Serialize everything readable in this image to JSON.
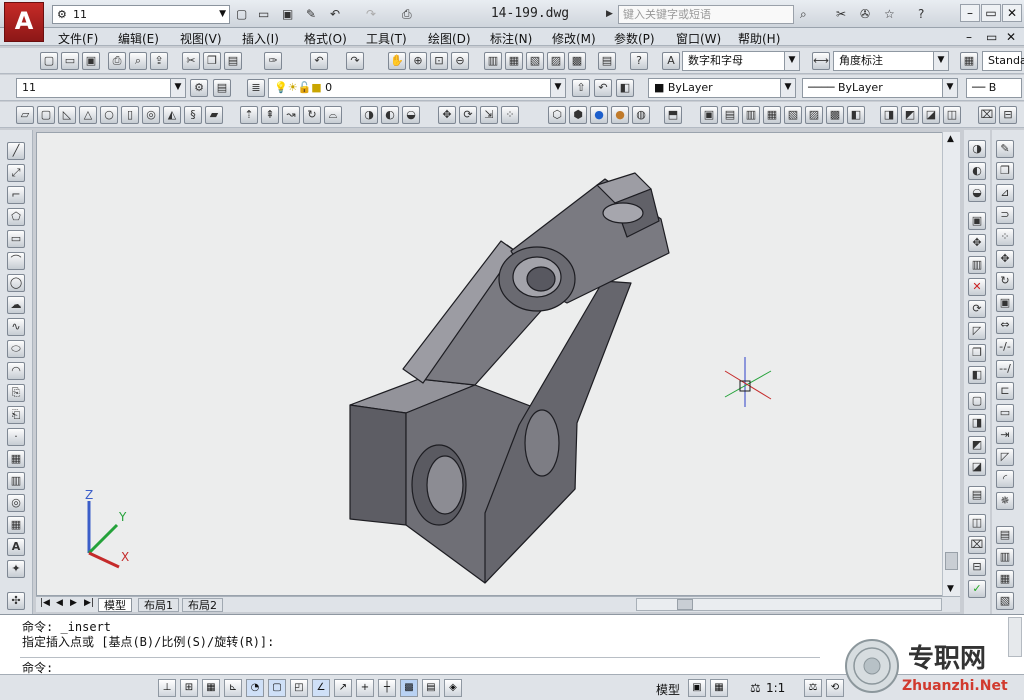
{
  "titlebar": {
    "workspace": "11",
    "filename": "14-199.dwg",
    "search_placeholder": "键入关键字或短语"
  },
  "menu": [
    "文件(F)",
    "编辑(E)",
    "视图(V)",
    "插入(I)",
    "格式(O)",
    "工具(T)",
    "绘图(D)",
    "标注(N)",
    "修改(M)",
    "参数(P)",
    "窗口(W)",
    "帮助(H)"
  ],
  "toolbar2": {
    "text_style": "数字和字母",
    "dim_style": "角度标注",
    "table_style": "Standa"
  },
  "toolbar3": {
    "layer_state": "11",
    "current_layer": "0",
    "color": "ByLayer",
    "linetype": "ByLayer",
    "lineweight": "B"
  },
  "tabs": [
    "模型",
    "布局1",
    "布局2"
  ],
  "command": {
    "line1": "命令: _insert",
    "line2": "指定插入点或 [基点(B)/比例(S)/旋转(R)]:",
    "line3": "命令:"
  },
  "status": {
    "model": "模型",
    "scale": "1:1"
  },
  "ucs": {
    "x": "X",
    "y": "Y",
    "z": "Z"
  },
  "watermark": {
    "cn": "专职网",
    "url": "Zhuanzhi.Net"
  },
  "colors": {
    "model_fill": "#6f6f76",
    "canvas": "#ececec",
    "accent": "#c62b27"
  }
}
